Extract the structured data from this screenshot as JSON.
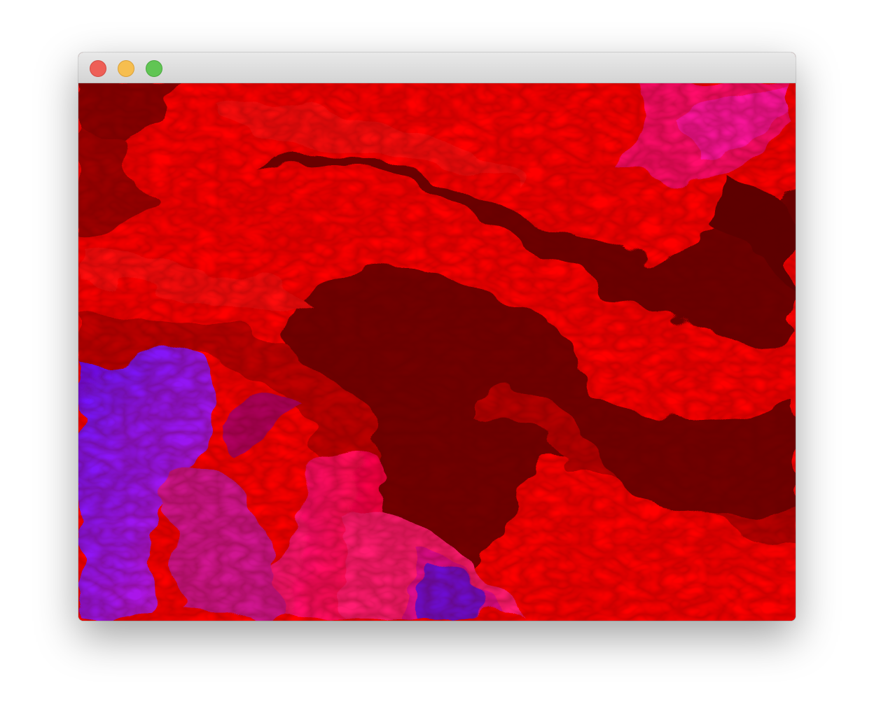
{
  "window": {
    "title": "",
    "controls": [
      {
        "name": "close-button",
        "color": "#ee5f57"
      },
      {
        "name": "minimize-button",
        "color": "#f6be4f"
      },
      {
        "name": "zoom-button",
        "color": "#61c554"
      }
    ]
  },
  "canvas": {
    "content": "fluid-simulation-render",
    "palette": {
      "bright_red": "#ff0000",
      "dark_red": "#6e0000",
      "mid_red": "#c80000",
      "magenta": "#ff1a6e",
      "pink": "#ff2db0",
      "violet": "#7a1cff"
    }
  }
}
